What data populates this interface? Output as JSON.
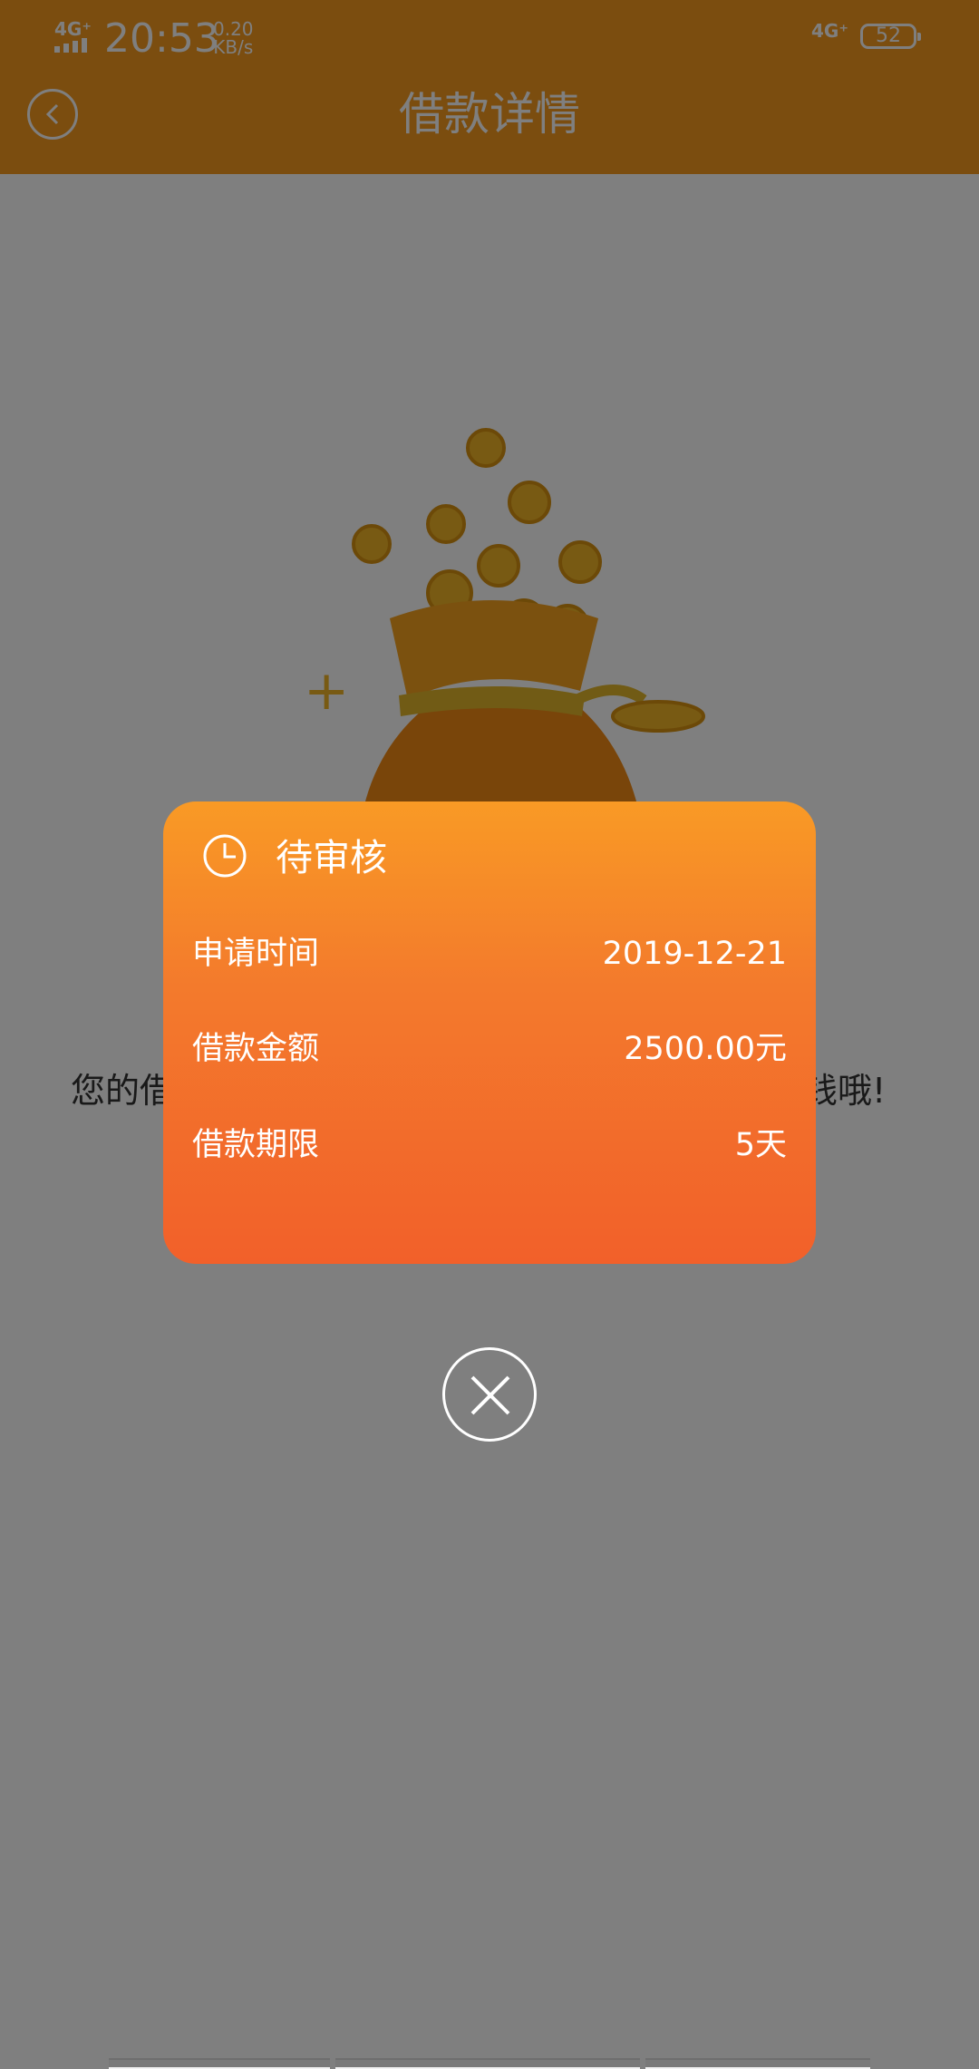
{
  "status_bar": {
    "network_left": "4G⁺",
    "time": "20:53",
    "speed_value": "0.20",
    "speed_unit": "KB/s",
    "network_right": "4G⁺",
    "battery": "52"
  },
  "nav": {
    "back_icon": "chevron-left-icon",
    "title": "借款详情"
  },
  "body": {
    "illustration_icon": "money-bag-icon",
    "message_left": "您的借",
    "message_right": "钱哦!"
  },
  "modal": {
    "status_icon": "clock-icon",
    "status_title": "待审核",
    "rows": [
      {
        "label": "申请时间",
        "value": "2019-12-21"
      },
      {
        "label": "借款金额",
        "value": "2500.00元"
      },
      {
        "label": "借款期限",
        "value": "5天"
      }
    ],
    "close_icon": "close-icon"
  },
  "colors": {
    "brand_orange": "#f79a1f",
    "modal_gradient_top": "#f99a25",
    "modal_gradient_bottom": "#f2602a"
  }
}
